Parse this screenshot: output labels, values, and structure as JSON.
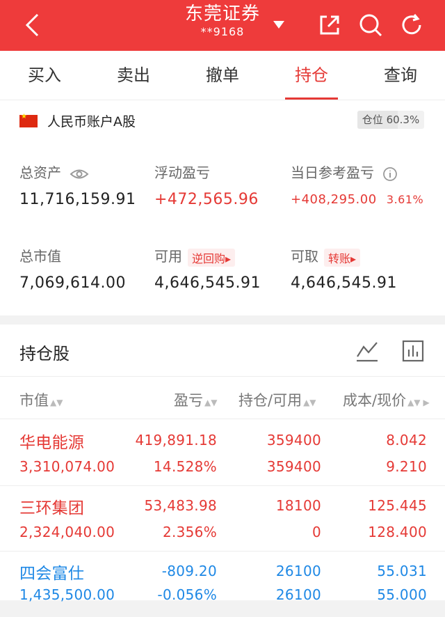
{
  "header": {
    "title": "东莞证券",
    "account": "**9168"
  },
  "tabs": [
    {
      "label": "买入"
    },
    {
      "label": "卖出"
    },
    {
      "label": "撤单"
    },
    {
      "label": "持仓"
    },
    {
      "label": "查询"
    }
  ],
  "account": {
    "name": "人民币账户A股",
    "position_label": "仓位",
    "position_ratio": "60.3%",
    "total_assets_label": "总资产",
    "total_assets": "11,716,159.91",
    "floating_pl_label": "浮动盈亏",
    "floating_pl": "+472,565.96",
    "today_pl_label": "当日参考盈亏",
    "today_pl": "+408,295.00",
    "today_pl_pct": "3.61%",
    "market_value_label": "总市值",
    "market_value": "7,069,614.00",
    "available_label": "可用",
    "reverse_repo_label": "逆回购▸",
    "available": "4,646,545.91",
    "withdrawable_label": "可取",
    "transfer_label": "转账▸",
    "withdrawable": "4,646,545.91"
  },
  "holdings": {
    "title": "持仓股",
    "columns": [
      "市值",
      "盈亏",
      "持仓/可用",
      "成本/现价"
    ],
    "rows": [
      {
        "name": "华电能源",
        "market_value": "3,310,074.00",
        "pl": "419,891.18",
        "pl_pct": "14.528%",
        "position": "359400",
        "available": "359400",
        "cost": "8.042",
        "price": "9.210",
        "status": "profit"
      },
      {
        "name": "三环集团",
        "market_value": "2,324,040.00",
        "pl": "53,483.98",
        "pl_pct": "2.356%",
        "position": "18100",
        "available": "0",
        "cost": "125.445",
        "price": "128.400",
        "status": "profit"
      },
      {
        "name": "四会富仕",
        "market_value": "1,435,500.00",
        "pl": "-809.20",
        "pl_pct": "-0.056%",
        "position": "26100",
        "available": "26100",
        "cost": "55.031",
        "price": "55.000",
        "status": "loss"
      }
    ]
  },
  "colors": {
    "header_bg": "#ee3b3b",
    "profit": "#e53935",
    "loss": "#1e88e5"
  }
}
